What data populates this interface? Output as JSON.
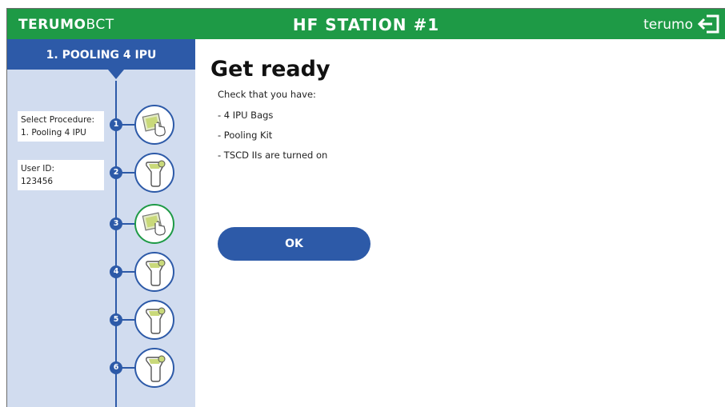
{
  "header": {
    "brand_bold": "TERUMO",
    "brand_light": "BCT",
    "station_title": "HF STATION #1",
    "user_label": "terumo",
    "exit_icon": "exit-icon",
    "bg_color": "#1e9a46"
  },
  "sidebar": {
    "current_step_title": "1. POOLING 4 IPU",
    "accent_color": "#2d5aa8",
    "procedure_card": {
      "label": "Select Procedure:",
      "value": "1. Pooling 4 IPU"
    },
    "user_card": {
      "label": "User ID:",
      "value": "123456"
    },
    "steps": [
      {
        "number": "1",
        "icon": "touch-screen-icon",
        "state": "done"
      },
      {
        "number": "2",
        "icon": "barcode-scanner-icon",
        "state": "done"
      },
      {
        "number": "3",
        "icon": "touch-screen-icon",
        "state": "active"
      },
      {
        "number": "4",
        "icon": "barcode-scanner-icon",
        "state": "pending"
      },
      {
        "number": "5",
        "icon": "barcode-scanner-icon",
        "state": "pending"
      },
      {
        "number": "6",
        "icon": "barcode-scanner-icon",
        "state": "pending"
      }
    ]
  },
  "main": {
    "title": "Get ready",
    "intro": "Check that you have:",
    "items": [
      "- 4 IPU Bags",
      "- Pooling Kit",
      "- TSCD IIs are turned on"
    ],
    "ok_label": "OK"
  }
}
